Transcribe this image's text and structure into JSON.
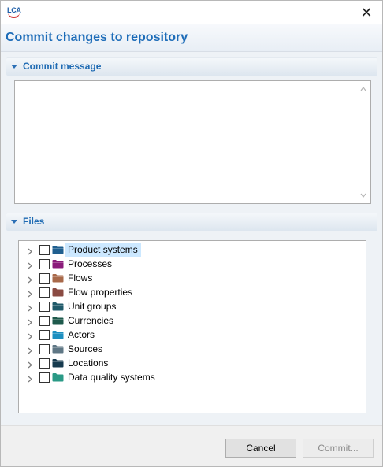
{
  "window": {
    "app_icon_text": "LCA",
    "close_glyph": "✕"
  },
  "dialog": {
    "title": "Commit changes to repository"
  },
  "commit_message_section": {
    "label": "Commit message",
    "message_value": ""
  },
  "files_section": {
    "label": "Files",
    "items": [
      {
        "label": "Product systems",
        "icon": "folder-icon",
        "color": "#1f5f8f",
        "selected": true
      },
      {
        "label": "Processes",
        "icon": "folder-icon",
        "color": "#8a1a7a",
        "selected": false
      },
      {
        "label": "Flows",
        "icon": "folder-icon",
        "color": "#a8694a",
        "selected": false
      },
      {
        "label": "Flow properties",
        "icon": "folder-icon",
        "color": "#8a4a42",
        "selected": false
      },
      {
        "label": "Unit groups",
        "icon": "folder-icon",
        "color": "#1f5a6a",
        "selected": false
      },
      {
        "label": "Currencies",
        "icon": "folder-icon",
        "color": "#1e5a4c",
        "selected": false
      },
      {
        "label": "Actors",
        "icon": "folder-icon",
        "color": "#1d8fc0",
        "selected": false
      },
      {
        "label": "Sources",
        "icon": "folder-icon",
        "color": "#5f7785",
        "selected": false
      },
      {
        "label": "Locations",
        "icon": "folder-icon",
        "color": "#163a4e",
        "selected": false
      },
      {
        "label": "Data quality systems",
        "icon": "folder-icon",
        "color": "#2a9a86",
        "selected": false
      }
    ]
  },
  "buttons": {
    "cancel_label": "Cancel",
    "commit_label": "Commit..."
  }
}
